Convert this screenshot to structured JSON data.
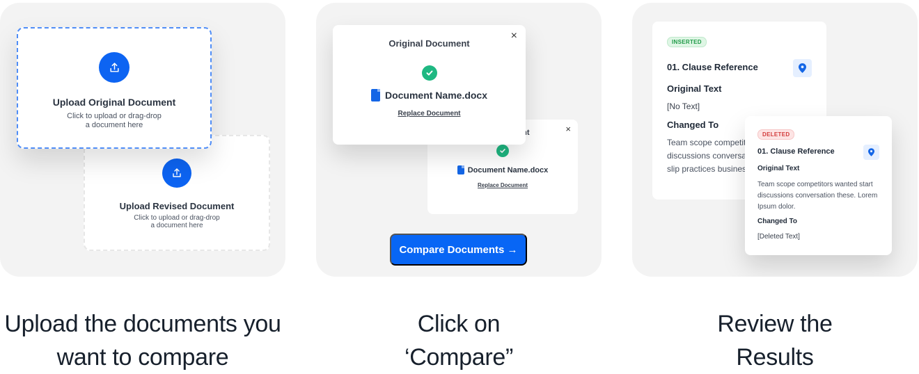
{
  "steps": [
    {
      "caption_lines": [
        "Upload the documents you",
        "want to compare"
      ],
      "original_upload": {
        "title": "Upload Original Document",
        "hint_lines": [
          "Click to upload or drag-drop",
          "a document here"
        ]
      },
      "revised_upload": {
        "title": "Upload Revised Document",
        "hint_lines": [
          "Click to upload or drag-drop",
          "a document here"
        ]
      }
    },
    {
      "caption_lines": [
        "Click on",
        "‘Compare”"
      ],
      "original_card": {
        "title": "Original Document",
        "close": "×",
        "file_name": "Document Name.docx",
        "replace_label": "Replace Document"
      },
      "revised_card": {
        "title_fragment": "ent",
        "close": "×",
        "file_name": "Document Name.docx",
        "replace_label": "Replace Document"
      },
      "compare_button": "Compare Documents →"
    },
    {
      "caption_lines": [
        "Review the",
        "Results"
      ],
      "inserted_card": {
        "badge": "INSERTED",
        "clause": "01. Clause Reference",
        "original_label": "Original Text",
        "original_value": "[No Text]",
        "changed_label": "Changed To",
        "changed_value": "Team scope competitors wanted start discussions conversation these. Revision slip practices business."
      },
      "deleted_card": {
        "badge": "DELETED",
        "clause": "01. Clause Reference",
        "original_label": "Original Text",
        "original_value": "Team scope competitors wanted start discussions conversation these. Lorem Ipsum dolor.",
        "changed_label": "Changed To",
        "changed_value": "[Deleted Text]"
      }
    }
  ],
  "icons": {
    "upload": "upload-icon",
    "check": "check-icon",
    "doc": "docx-file-icon",
    "pin": "location-pin-icon"
  },
  "colors": {
    "primary_blue": "#0866f5",
    "success_green": "#1fb882",
    "inserted_green": "#1f9a47",
    "deleted_red": "#d23b3b",
    "panel_bg": "#f3f3f3"
  }
}
